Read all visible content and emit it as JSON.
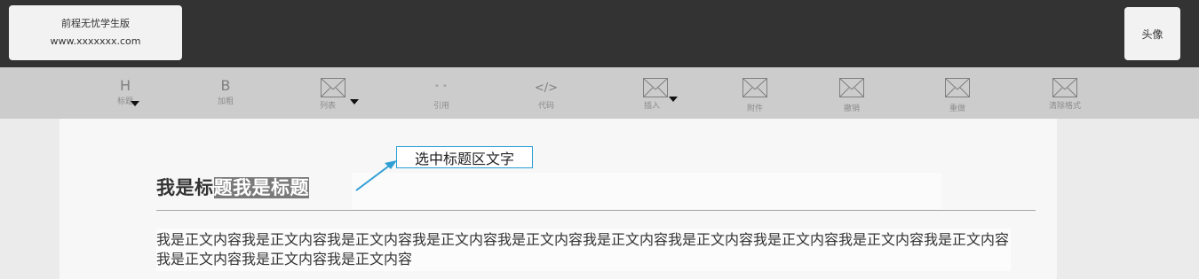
{
  "header": {
    "logo_title": "前程无忧学生版",
    "logo_url": "www.xxxxxxx.com",
    "avatar_label": "头像"
  },
  "toolbar": {
    "items": [
      {
        "name": "heading",
        "glyph": "H",
        "label": "标题",
        "icon": "heading-icon",
        "dropdown": true
      },
      {
        "name": "bold",
        "glyph": "B",
        "label": "加粗",
        "icon": "bold-icon",
        "dropdown": false
      },
      {
        "name": "list",
        "glyph": "",
        "label": "列表",
        "icon": "list-placeholder-icon",
        "dropdown": true
      },
      {
        "name": "quote",
        "glyph": "\" \"",
        "label": "引用",
        "icon": "quote-icon",
        "dropdown": false
      },
      {
        "name": "code",
        "glyph": "</>",
        "label": "代码",
        "icon": "code-icon",
        "dropdown": false
      },
      {
        "name": "insert",
        "glyph": "",
        "label": "插入",
        "icon": "insert-placeholder-icon",
        "dropdown": true
      },
      {
        "name": "attachment",
        "glyph": "",
        "label": "附件",
        "icon": "attachment-placeholder-icon",
        "dropdown": false
      },
      {
        "name": "undo",
        "glyph": "",
        "label": "撤销",
        "icon": "undo-placeholder-icon",
        "dropdown": false
      },
      {
        "name": "redo",
        "glyph": "",
        "label": "重做",
        "icon": "redo-placeholder-icon",
        "dropdown": false
      },
      {
        "name": "clear-format",
        "glyph": "",
        "label": "清除格式",
        "icon": "clear-format-placeholder-icon",
        "dropdown": false
      }
    ]
  },
  "editor": {
    "title_plain": "我是标",
    "title_selected": "题我是标题",
    "body": "我是正文内容我是正文内容我是正文内容我是正文内容我是正文内容我是正文内容我是正文内容我是正文内容我是正文内容我是正文内容我是正文内容我是正文内容我是正文内容"
  },
  "annotation": {
    "callout_text": "选中标题区文字"
  },
  "colors": {
    "header_bg": "#333333",
    "toolbar_bg": "#cccccc",
    "selection_bg": "#7a7a7a",
    "callout_border": "#2e9fd4"
  }
}
